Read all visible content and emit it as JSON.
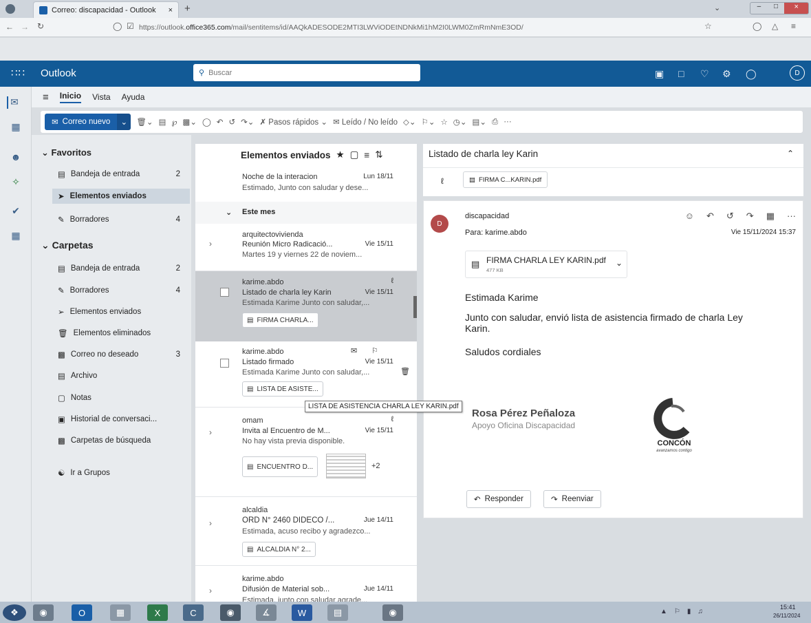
{
  "browser": {
    "tab_title": "Correo: discapacidad - Outlook",
    "tab_close": "×",
    "new_tab": "+",
    "url_prefix": "https://outlook.",
    "url_domain": "office365.com",
    "url_rest": "/mail/sentitems/id/AAQkADESODE2MTI3LWViODEtNDNkMi1hM2I0LWM0ZmRmNmE3OD/"
  },
  "app": {
    "brand": "Outlook",
    "search_placeholder": "Buscar",
    "avatar_initial": "D"
  },
  "ribbon": {
    "tabs": [
      "Inicio",
      "Vista",
      "Ayuda"
    ],
    "new_mail": "Correo nuevo",
    "quick_steps": "Pasos rápidos",
    "read_unread": "Leído / No leído",
    "more": "···"
  },
  "folders": {
    "favorites_label": "Favoritos",
    "favorites": [
      {
        "label": "Bandeja de entrada",
        "count": "2",
        "icon": "inbox-icon"
      },
      {
        "label": "Elementos enviados",
        "count": "",
        "icon": "send-icon"
      },
      {
        "label": "Borradores",
        "count": "4",
        "icon": "draft-icon"
      }
    ],
    "folders_label": "Carpetas",
    "items": [
      {
        "label": "Bandeja de entrada",
        "count": "2",
        "icon": "inbox-icon"
      },
      {
        "label": "Borradores",
        "count": "4",
        "icon": "draft-icon"
      },
      {
        "label": "Elementos enviados",
        "count": "",
        "icon": "send-icon"
      },
      {
        "label": "Elementos eliminados",
        "count": "",
        "icon": "trash-icon"
      },
      {
        "label": "Correo no deseado",
        "count": "3",
        "icon": "junk-icon"
      },
      {
        "label": "Archivo",
        "count": "",
        "icon": "archive-icon"
      },
      {
        "label": "Notas",
        "count": "",
        "icon": "notes-icon"
      },
      {
        "label": "Historial de conversaci...",
        "count": "",
        "icon": "history-icon"
      },
      {
        "label": "Carpetas de búsqueda",
        "count": "",
        "icon": "search-folder-icon"
      }
    ],
    "groups": "Ir a Grupos"
  },
  "list": {
    "title": "Elementos enviados",
    "top_msg": {
      "subject": "Noche de la interacion",
      "date": "Lun 18/11",
      "preview": "Estimado, Junto con saludar y dese..."
    },
    "month_header": "Este mes",
    "messages": [
      {
        "from": "arquitectovivienda",
        "subject": "Reunión Micro Radicació...",
        "date": "Vie 15/11",
        "preview": "Martes 19 y viernes 22 de noviem..."
      },
      {
        "from": "karime.abdo",
        "subject": "Listado de charla ley Karin",
        "date": "Vie 15/11",
        "preview": "Estimada Karime Junto con saludar,...",
        "chip": "FIRMA CHARLA..."
      },
      {
        "from": "karime.abdo",
        "subject": "Listado firmado",
        "date": "Vie 15/11",
        "preview": "Estimada Karime Junto con saludar,...",
        "chip": "LISTA DE ASISTE..."
      },
      {
        "from": "omam",
        "subject": "Invita al Encuentro de M...",
        "date": "Vie 15/11",
        "preview": "No hay vista previa disponible.",
        "chip": "ENCUENTRO D...",
        "extra": "+2"
      },
      {
        "from": "alcaldia",
        "subject": "ORD N° 2460 DIDECO /...",
        "date": "Jue 14/11",
        "preview": "Estimada, acuso recibo y agradezco...",
        "chip": "ALCALDIA N° 2..."
      },
      {
        "from": "karime.abdo",
        "subject": "Difusión de Material sob...",
        "date": "Jue 14/11",
        "preview": "Estimada, junto con saludar agrade..."
      }
    ],
    "tooltip": "LISTA DE ASISTENCIA CHARLA LEY KARIN.pdf"
  },
  "reading": {
    "subject": "Listado de charla ley Karin",
    "top_attachment": "FIRMA C...KARIN.pdf",
    "sender": "discapacidad",
    "avatar": "D",
    "to_label": "Para:",
    "to": "karime.abdo",
    "datetime": "Vie 15/11/2024 15:37",
    "attachment_name": "FIRMA CHARLA LEY KARIN.pdf",
    "attachment_size": "477 KB",
    "greeting": "Estimada Karime",
    "body": "Junto con saludar, envió lista de asistencia firmado de charla Ley Karin.",
    "closing": "Saludos cordiales",
    "sig_name": "Rosa Pérez Peñaloza",
    "sig_role": "Apoyo Oficina Discapacidad",
    "logo_text": "CONCÓN",
    "logo_tagline": "avanzamos contigo",
    "reply": "Responder",
    "forward": "Reenviar"
  },
  "taskbar": {
    "time": "15:41",
    "date": "26/11/2024"
  },
  "colors": {
    "brand_blue": "#125a96",
    "accent": "#1a5fa8",
    "selected_row": "#c9ccd0"
  }
}
